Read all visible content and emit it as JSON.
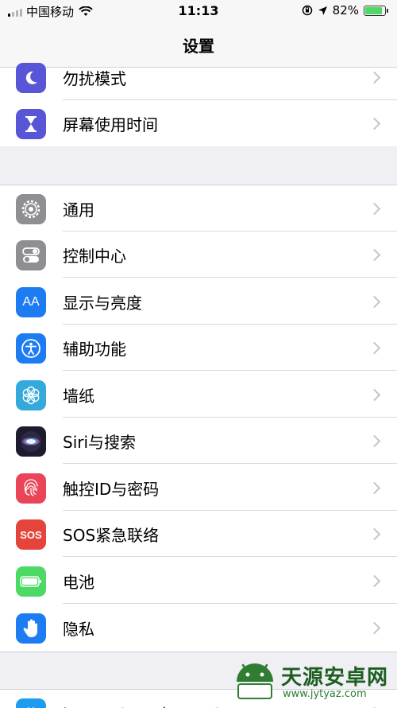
{
  "status_bar": {
    "carrier": "中国移动",
    "time": "11:13",
    "battery_percent": "82%"
  },
  "nav": {
    "title": "设置"
  },
  "group1": [
    {
      "label": "勿扰模式",
      "icon": "moon-icon",
      "color": "#5856d6"
    },
    {
      "label": "屏幕使用时间",
      "icon": "hourglass-icon",
      "color": "#5856d6"
    }
  ],
  "group2": [
    {
      "label": "通用",
      "icon": "gear-icon",
      "color": "#8e8e93"
    },
    {
      "label": "控制中心",
      "icon": "toggles-icon",
      "color": "#8e8e93"
    },
    {
      "label": "显示与亮度",
      "icon": "aa-icon",
      "icon_text": "AA",
      "color": "#1e7cf2"
    },
    {
      "label": "辅助功能",
      "icon": "accessibility-icon",
      "color": "#1e7cf2"
    },
    {
      "label": "墙纸",
      "icon": "flower-icon",
      "color": "#34aadc"
    },
    {
      "label": "Siri与搜索",
      "icon": "siri-icon",
      "color": "#1c1c2e"
    },
    {
      "label": "触控ID与密码",
      "icon": "fingerprint-icon",
      "color": "#ea4459"
    },
    {
      "label": "SOS紧急联络",
      "icon": "sos-icon",
      "icon_text": "SOS",
      "color": "#e5443a"
    },
    {
      "label": "电池",
      "icon": "battery-icon",
      "color": "#4cd964"
    },
    {
      "label": "隐私",
      "icon": "hand-icon",
      "color": "#1e7cf2"
    }
  ],
  "group3": [
    {
      "label": "iTunes Store与App Store",
      "icon": "app-store-icon",
      "color": "#1e9cf2"
    }
  ],
  "watermark": {
    "name": "天源安卓网",
    "url": "www.jytyaz.com"
  }
}
